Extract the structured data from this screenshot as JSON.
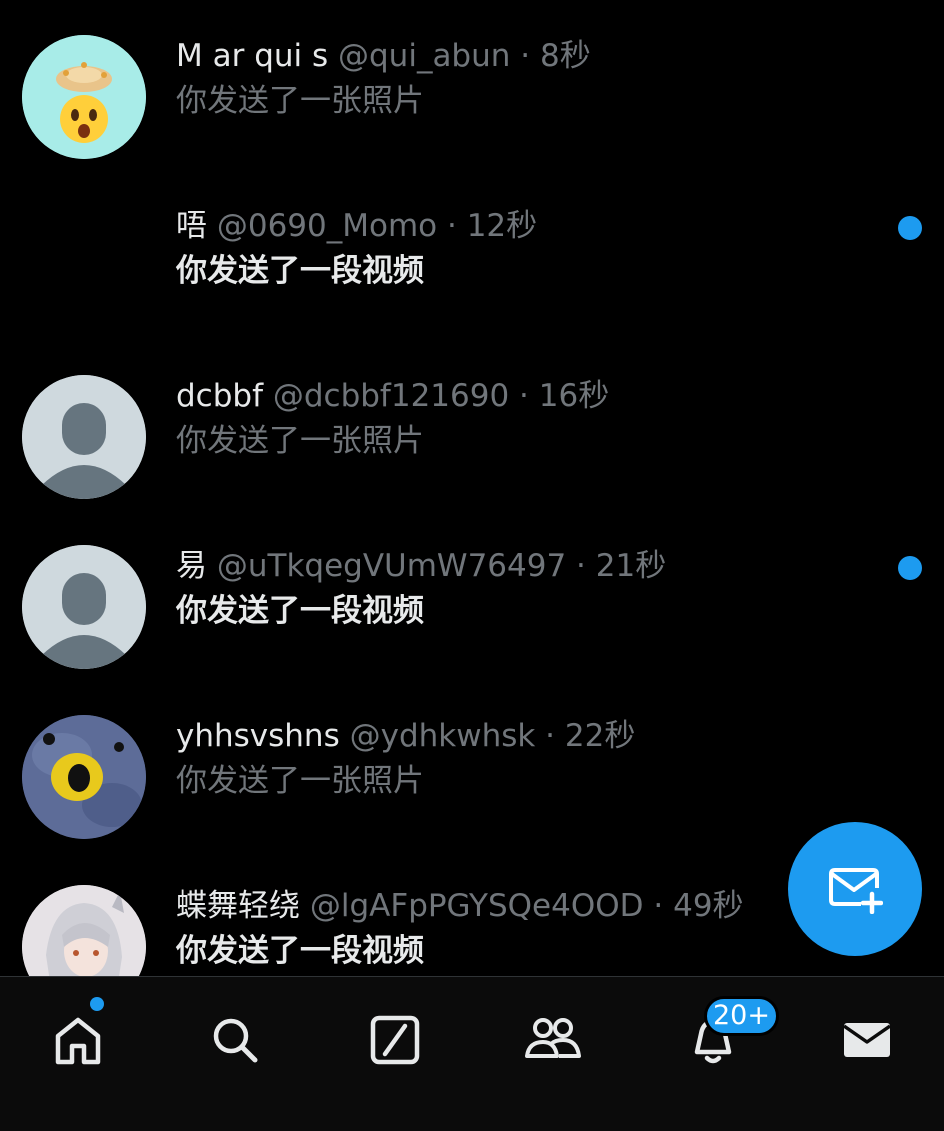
{
  "conversations": [
    {
      "name": "M ar qui s",
      "handle": "@qui_abun",
      "time": "8秒",
      "preview": "你发送了一张照片",
      "unread": false,
      "avatar": "exploding-head-emoji"
    },
    {
      "name": "唔",
      "handle": "@0690_Momo",
      "time": "12秒",
      "preview": "你发送了一段视频",
      "unread": true,
      "avatar": "none"
    },
    {
      "name": "dcbbf",
      "handle": "@dcbbf121690",
      "time": "16秒",
      "preview": "你发送了一张照片",
      "unread": false,
      "avatar": "default-profile"
    },
    {
      "name": "易",
      "handle": "@uTkqegVUmW76497",
      "time": "21秒",
      "preview": "你发送了一段视频",
      "unread": true,
      "avatar": "default-profile"
    },
    {
      "name": "yhhsvshns",
      "handle": "@ydhkwhsk",
      "time": "22秒",
      "preview": "你发送了一张照片",
      "unread": false,
      "avatar": "blurred-bird-photo"
    },
    {
      "name": "蝶舞轻绕",
      "handle": "@lgAFpPGYSQe4OOD",
      "time": "49秒",
      "preview": "你发送了一段视频",
      "unread": false,
      "avatar": "anime-girl-illustration"
    }
  ],
  "separator": " · ",
  "fab": {
    "icon": "new-message-icon"
  },
  "tabbar": {
    "items": [
      "home-icon",
      "search-icon",
      "grok-icon",
      "communities-icon",
      "notifications-icon",
      "messages-icon"
    ],
    "notifications_badge": "20+"
  },
  "colors": {
    "accent": "#1d9bf0",
    "background": "#000000",
    "text": "#e7e9ea",
    "muted": "#71767b"
  }
}
